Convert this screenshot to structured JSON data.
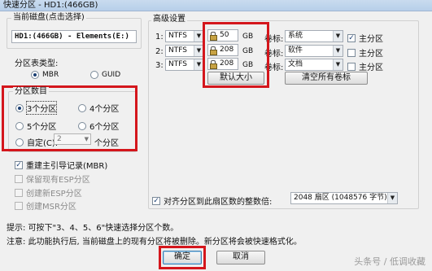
{
  "window": {
    "title": "快速分区 - HD1:(466GB)"
  },
  "disk": {
    "group_label": "当前磁盘(点击选择)",
    "value": "HD1:(466GB) - Elements(E:)"
  },
  "partition_type": {
    "label": "分区表类型:",
    "options": [
      {
        "label": "MBR",
        "selected": true
      },
      {
        "label": "GUID",
        "selected": false
      }
    ]
  },
  "partition_count": {
    "group_label": "分区数目",
    "options": [
      {
        "label": "3个分区",
        "selected": true
      },
      {
        "label": "4个分区",
        "selected": false
      },
      {
        "label": "5个分区",
        "selected": false
      },
      {
        "label": "6个分区",
        "selected": false
      }
    ],
    "custom_label": "自定(C):",
    "custom_value": "2",
    "custom_suffix": "个分区"
  },
  "options": {
    "rebuild_mbr": "重建主引导记录(MBR)",
    "keep_esp": "保留现有ESP分区",
    "create_esp": "创建新ESP分区",
    "create_msr": "创建MSR分区"
  },
  "advanced": {
    "group_label": "高级设置",
    "rows": [
      {
        "index": "1:",
        "fs": "NTFS",
        "size": "50",
        "unit": "GB",
        "volume_label": "卷标:",
        "volume": "系统",
        "primary_label": "主分区",
        "primary": true
      },
      {
        "index": "2:",
        "fs": "NTFS",
        "size": "208",
        "unit": "GB",
        "volume_label": "卷标:",
        "volume": "软件",
        "primary_label": "主分区",
        "primary": false
      },
      {
        "index": "3:",
        "fs": "NTFS",
        "size": "208",
        "unit": "GB",
        "volume_label": "卷标:",
        "volume": "文档",
        "primary_label": "主分区",
        "primary": false
      }
    ],
    "default_size_button": "默认大小",
    "clear_labels_button": "清空所有卷标",
    "align_label": "对齐分区到此扇区数的整数倍:",
    "align_value": "2048 扇区 (1048576 字节)"
  },
  "footer": {
    "hint": "提示: 可按下\"3、4、5、6\"快速选择分区个数。",
    "note": "注意: 此功能执行后, 当前磁盘上的现有分区将被删除。新分区将会被快速格式化。",
    "ok_button": "确定",
    "cancel_button": "取消"
  },
  "watermark": "头条号 / 低调收藏",
  "colors": {
    "highlight_red": "#d4161c",
    "selected_dot": "#1a3e72"
  }
}
